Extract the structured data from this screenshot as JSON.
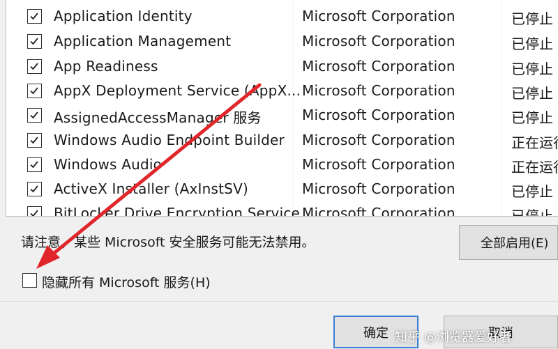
{
  "services": [
    {
      "name": "Application Identity",
      "manufacturer": "Microsoft Corporation",
      "status": "已停止",
      "checked": true
    },
    {
      "name": "Application Management",
      "manufacturer": "Microsoft Corporation",
      "status": "已停止",
      "checked": true
    },
    {
      "name": "App Readiness",
      "manufacturer": "Microsoft Corporation",
      "status": "已停止",
      "checked": true
    },
    {
      "name": "AppX Deployment Service (AppX...",
      "manufacturer": "Microsoft Corporation",
      "status": "已停止",
      "checked": true
    },
    {
      "name": "AssignedAccessManager 服务",
      "manufacturer": "Microsoft Corporation",
      "status": "已停止",
      "checked": true
    },
    {
      "name": "Windows Audio Endpoint Builder",
      "manufacturer": "Microsoft Corporation",
      "status": "正在运行",
      "checked": true
    },
    {
      "name": "Windows Audio",
      "manufacturer": "Microsoft Corporation",
      "status": "正在运行",
      "checked": true
    },
    {
      "name": "ActiveX Installer (AxInstSV)",
      "manufacturer": "Microsoft Corporation",
      "status": "已停止",
      "checked": true
    },
    {
      "name": "BitLocker Drive Encryption Service",
      "manufacturer": "Microsoft Corporation",
      "status": "已停止",
      "checked": true
    }
  ],
  "notice": "请注意，某些 Microsoft 安全服务可能无法禁用。",
  "enable_all_button": "全部启用(E)",
  "hide_ms_services": {
    "label": "隐藏所有 Microsoft 服务(H)",
    "checked": false
  },
  "ok_button": "确定",
  "cancel_button": "取消",
  "watermark": "知乎 @浏览器爱好者",
  "colors": {
    "arrow": "#e0262a",
    "focus_border": "#3c7fd6"
  },
  "icons": {
    "checkbox_checked": "checkmark-icon",
    "annotation": "red-arrow"
  }
}
